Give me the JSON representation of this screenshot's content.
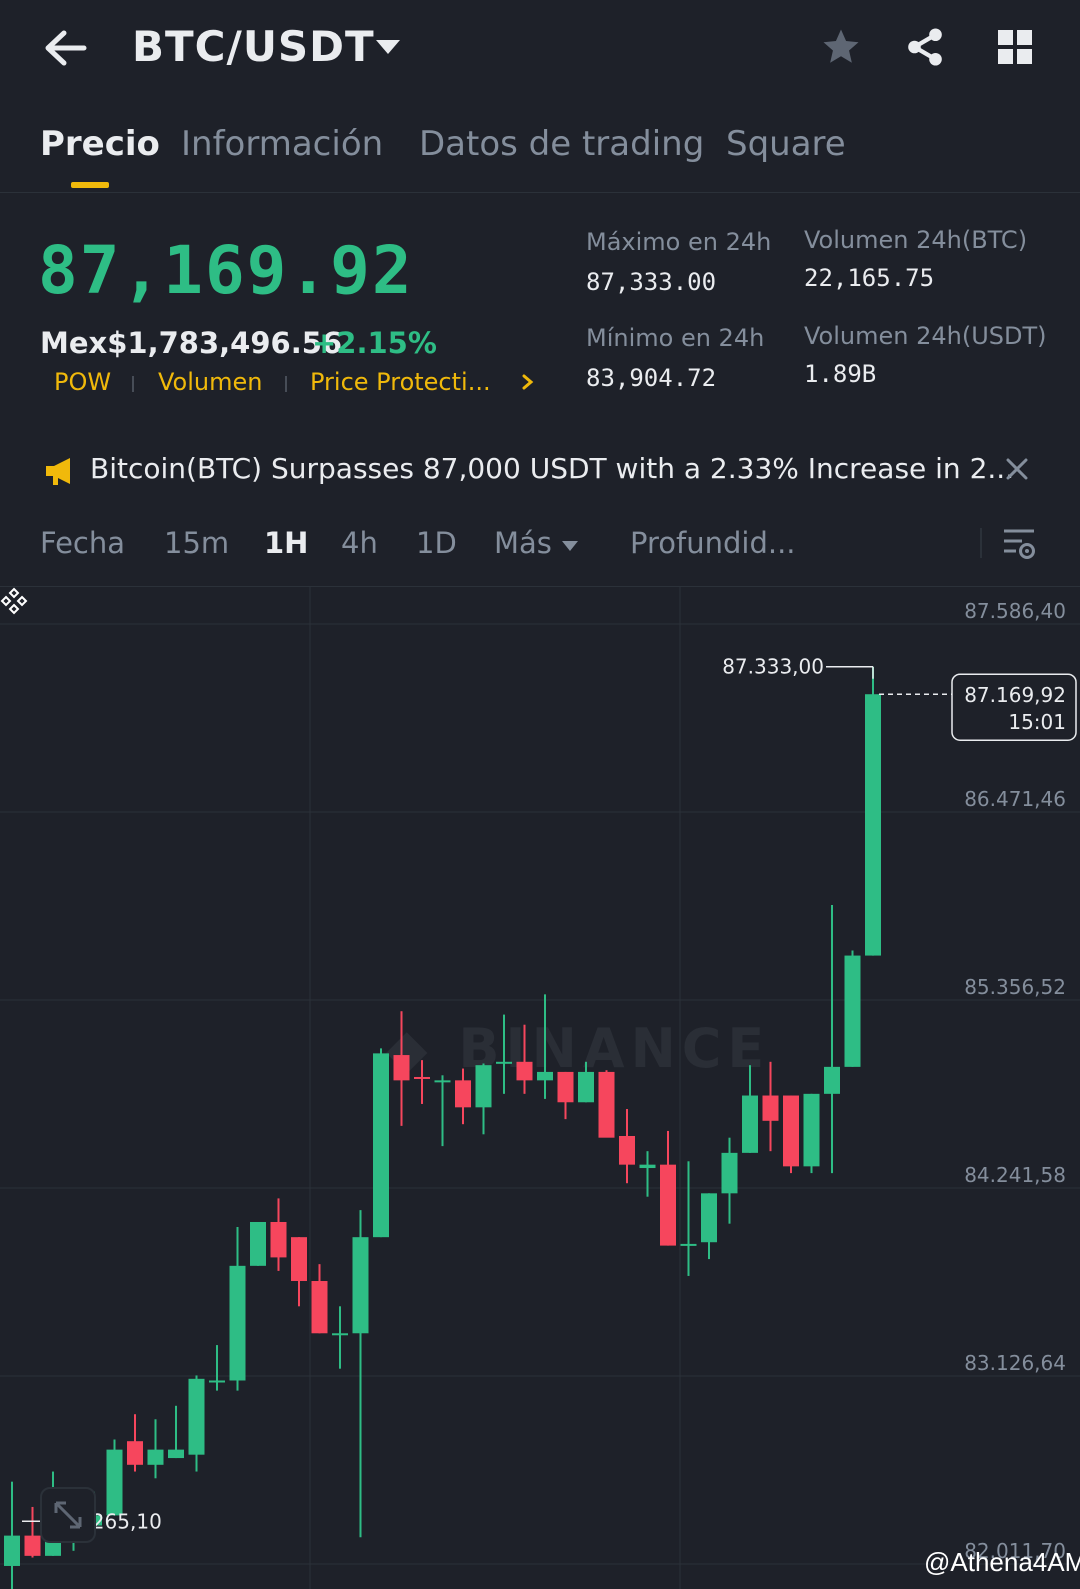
{
  "header": {
    "pair": "BTC/USDT",
    "back_icon": "arrow-left-icon",
    "favorite_icon": "star-icon",
    "share_icon": "share-icon",
    "menu_icon": "grid-icon"
  },
  "tabs": [
    {
      "label": "Precio",
      "active": true
    },
    {
      "label": "Información",
      "active": false
    },
    {
      "label": "Datos de trading",
      "active": false
    },
    {
      "label": "Square",
      "active": false
    }
  ],
  "price": {
    "last": "87,169.92",
    "fiat": "Mex$1,783,496.56",
    "change": "+2.15%",
    "tags": [
      "POW",
      "Volumen",
      "Price Protecti..."
    ]
  },
  "stats": {
    "high_label": "Máximo en 24h",
    "high_value": "87,333.00",
    "low_label": "Mínimo en 24h",
    "low_value": "83,904.72",
    "vol_btc_label": "Volumen 24h(BTC)",
    "vol_btc_value": "22,165.75",
    "vol_usdt_label": "Volumen 24h(USDT)",
    "vol_usdt_value": "1.89B"
  },
  "news": {
    "text": "Bitcoin(BTC) Surpasses 87,000 USDT with a 2.33% Increase in 2...",
    "icon": "megaphone-icon"
  },
  "intervals": {
    "items": [
      "Fecha",
      "15m",
      "1H",
      "4h",
      "1D",
      "Más",
      "Profundid..."
    ],
    "active": "1H"
  },
  "chart_data": {
    "type": "candlestick",
    "y_ticks": [
      "87.586,40",
      "86.471,46",
      "85.356,52",
      "84.241,58",
      "83.126,64",
      "82.011,70"
    ],
    "ylim": [
      82011.7,
      87586.4
    ],
    "high_marker": "87.333,00",
    "low_marker": "82.265,10",
    "last_price_label": "87.169,92",
    "countdown": "15:01",
    "colors": {
      "up": "#2ebd85",
      "down": "#f6465d"
    },
    "candles": [
      {
        "o": 82000,
        "h": 82500,
        "l": 81800,
        "c": 82180
      },
      {
        "o": 82180,
        "h": 82350,
        "l": 82050,
        "c": 82060
      },
      {
        "o": 82060,
        "h": 82560,
        "l": 82060,
        "c": 82210
      },
      {
        "o": 82180,
        "h": 82430,
        "l": 82090,
        "c": 82240
      },
      {
        "o": 82240,
        "h": 82440,
        "l": 82240,
        "c": 82300
      },
      {
        "o": 82300,
        "h": 82750,
        "l": 82300,
        "c": 82690
      },
      {
        "o": 82740,
        "h": 82900,
        "l": 82560,
        "c": 82600
      },
      {
        "o": 82600,
        "h": 82870,
        "l": 82520,
        "c": 82690
      },
      {
        "o": 82640,
        "h": 82950,
        "l": 82640,
        "c": 82690
      },
      {
        "o": 82660,
        "h": 83130,
        "l": 82560,
        "c": 83110
      },
      {
        "o": 83100,
        "h": 83310,
        "l": 83040,
        "c": 83100
      },
      {
        "o": 83100,
        "h": 84010,
        "l": 83040,
        "c": 83780
      },
      {
        "o": 83780,
        "h": 84040,
        "l": 83780,
        "c": 84040
      },
      {
        "o": 84040,
        "h": 84180,
        "l": 83750,
        "c": 83830
      },
      {
        "o": 83950,
        "h": 83950,
        "l": 83540,
        "c": 83690
      },
      {
        "o": 83690,
        "h": 83790,
        "l": 83380,
        "c": 83380
      },
      {
        "o": 83380,
        "h": 83540,
        "l": 83170,
        "c": 83380
      },
      {
        "o": 83380,
        "h": 84110,
        "l": 82170,
        "c": 83950
      },
      {
        "o": 83950,
        "h": 85070,
        "l": 83950,
        "c": 85040
      },
      {
        "o": 85030,
        "h": 85290,
        "l": 84610,
        "c": 84880
      },
      {
        "o": 84900,
        "h": 85000,
        "l": 84740,
        "c": 84890
      },
      {
        "o": 84880,
        "h": 84910,
        "l": 84490,
        "c": 84880
      },
      {
        "o": 84880,
        "h": 84950,
        "l": 84620,
        "c": 84720
      },
      {
        "o": 84720,
        "h": 84980,
        "l": 84560,
        "c": 84970
      },
      {
        "o": 84990,
        "h": 85270,
        "l": 84800,
        "c": 84990
      },
      {
        "o": 84990,
        "h": 85210,
        "l": 84800,
        "c": 84880
      },
      {
        "o": 84880,
        "h": 85390,
        "l": 84770,
        "c": 84930
      },
      {
        "o": 84930,
        "h": 84930,
        "l": 84650,
        "c": 84750
      },
      {
        "o": 84750,
        "h": 84990,
        "l": 84750,
        "c": 84930
      },
      {
        "o": 84930,
        "h": 84940,
        "l": 84560,
        "c": 84540
      },
      {
        "o": 84550,
        "h": 84710,
        "l": 84270,
        "c": 84380
      },
      {
        "o": 84360,
        "h": 84460,
        "l": 84190,
        "c": 84380
      },
      {
        "o": 84380,
        "h": 84580,
        "l": 83900,
        "c": 83900
      },
      {
        "o": 83900,
        "h": 84400,
        "l": 83720,
        "c": 83910
      },
      {
        "o": 83920,
        "h": 84210,
        "l": 83820,
        "c": 84210
      },
      {
        "o": 84210,
        "h": 84540,
        "l": 84030,
        "c": 84450
      },
      {
        "o": 84450,
        "h": 84970,
        "l": 84450,
        "c": 84790
      },
      {
        "o": 84790,
        "h": 84990,
        "l": 84460,
        "c": 84640
      },
      {
        "o": 84790,
        "h": 84790,
        "l": 84330,
        "c": 84370
      },
      {
        "o": 84370,
        "h": 84800,
        "l": 84330,
        "c": 84800
      },
      {
        "o": 84800,
        "h": 85920,
        "l": 84330,
        "c": 84960
      },
      {
        "o": 84960,
        "h": 85650,
        "l": 84960,
        "c": 85620
      },
      {
        "o": 85620,
        "h": 87333,
        "l": 85620,
        "c": 87169.92
      }
    ]
  },
  "footer": {
    "credit": "@Athena4AM"
  }
}
